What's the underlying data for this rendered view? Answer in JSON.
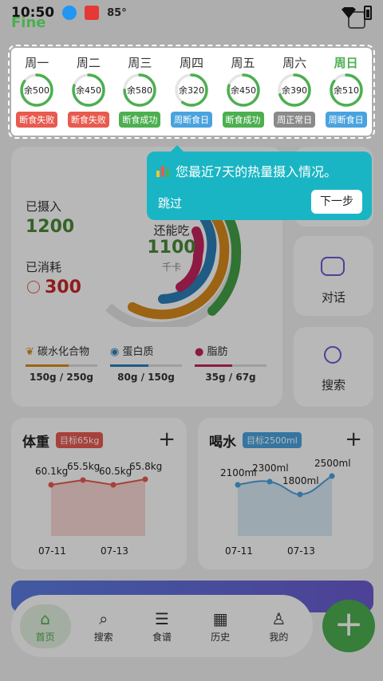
{
  "status": {
    "time": "10:50",
    "temp": "85°"
  },
  "logo": "Fine",
  "week": [
    {
      "day": "周一",
      "remain": "余500",
      "tag": "断食失败",
      "color": "#e85a4f",
      "progress": 0.85,
      "today": false
    },
    {
      "day": "周二",
      "remain": "余450",
      "tag": "断食失败",
      "color": "#e85a4f",
      "progress": 0.8,
      "today": false
    },
    {
      "day": "周三",
      "remain": "余580",
      "tag": "断食成功",
      "color": "#4caf50",
      "progress": 0.75,
      "today": false
    },
    {
      "day": "周四",
      "remain": "余320",
      "tag": "周断食日",
      "color": "#4aa3df",
      "progress": 0.6,
      "today": false
    },
    {
      "day": "周五",
      "remain": "余450",
      "tag": "断食成功",
      "color": "#4caf50",
      "progress": 0.8,
      "today": false
    },
    {
      "day": "周六",
      "remain": "余390",
      "tag": "周正常日",
      "color": "#8a8a8a",
      "progress": 0.7,
      "today": false
    },
    {
      "day": "周日",
      "remain": "余510",
      "tag": "周断食日",
      "color": "#4aa3df",
      "progress": 0.85,
      "today": true
    }
  ],
  "tooltip": {
    "message": "您最近7天的热量摄入情况。",
    "skip": "跳过",
    "next": "下一步"
  },
  "summary": {
    "intake_label": "已摄入",
    "intake_value": "1200",
    "burn_label": "已消耗",
    "burn_value": "300",
    "remain_label": "还能吃",
    "remain_value": "1100",
    "unit": "千卡"
  },
  "macros": [
    {
      "name": "碳水化合物",
      "value": "150g / 250g",
      "color": "#d98a1a",
      "ratio": 0.6
    },
    {
      "name": "蛋白质",
      "value": "80g / 150g",
      "color": "#2b7fb8",
      "ratio": 0.53
    },
    {
      "name": "脂肪",
      "value": "35g / 67g",
      "color": "#c2255c",
      "ratio": 0.52
    }
  ],
  "side": {
    "chat": "对话",
    "search": "搜索"
  },
  "weight": {
    "title": "体重",
    "goal": "目标65kg",
    "points": [
      "60.1kg",
      "65.5kg",
      "60.5kg",
      "65.8kg"
    ],
    "dates": [
      "07-11",
      "07-13"
    ]
  },
  "water": {
    "title": "喝水",
    "goal": "目标2500ml",
    "points": [
      "2100ml",
      "2300ml",
      "1800ml",
      "2500ml"
    ],
    "dates": [
      "07-11",
      "07-13"
    ]
  },
  "nav": [
    {
      "label": "首页",
      "icon": "⌂"
    },
    {
      "label": "搜索",
      "icon": "⌕"
    },
    {
      "label": "食谱",
      "icon": "☰"
    },
    {
      "label": "历史",
      "icon": "▦"
    },
    {
      "label": "我的",
      "icon": "♙"
    }
  ],
  "colors": {
    "accent": "#4caf50",
    "tooltip": "#1ab5c4",
    "ring_green": "#43a047",
    "ring_orange": "#d98a1a",
    "ring_blue": "#2b7fb8",
    "ring_red": "#c2255c"
  }
}
